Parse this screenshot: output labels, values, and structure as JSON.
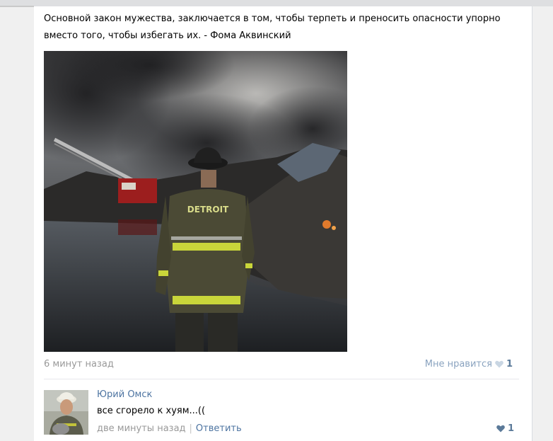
{
  "post": {
    "text": "Основной закон мужества, заключается в том, чтобы терпеть и преносить опасности упорно вместо того, чтобы избегать их. - Фома Аквинский",
    "photo_caption": "DETROIT",
    "time": "6 минут назад",
    "like_label": "Мне нравится",
    "like_count": "1"
  },
  "comment": {
    "author": "Юрий Омск",
    "text": "все сгорело к хуям...((",
    "time": "две минуты назад",
    "separator": "|",
    "reply_label": "Ответить",
    "like_count": "1"
  },
  "colors": {
    "link": "#4d74a1",
    "muted": "#999999",
    "like_heart_inactive": "#c9d6e3",
    "like_heart_active": "#5b7a99"
  },
  "icons": {
    "post_like": "heart-icon",
    "comment_like": "heart-icon"
  }
}
